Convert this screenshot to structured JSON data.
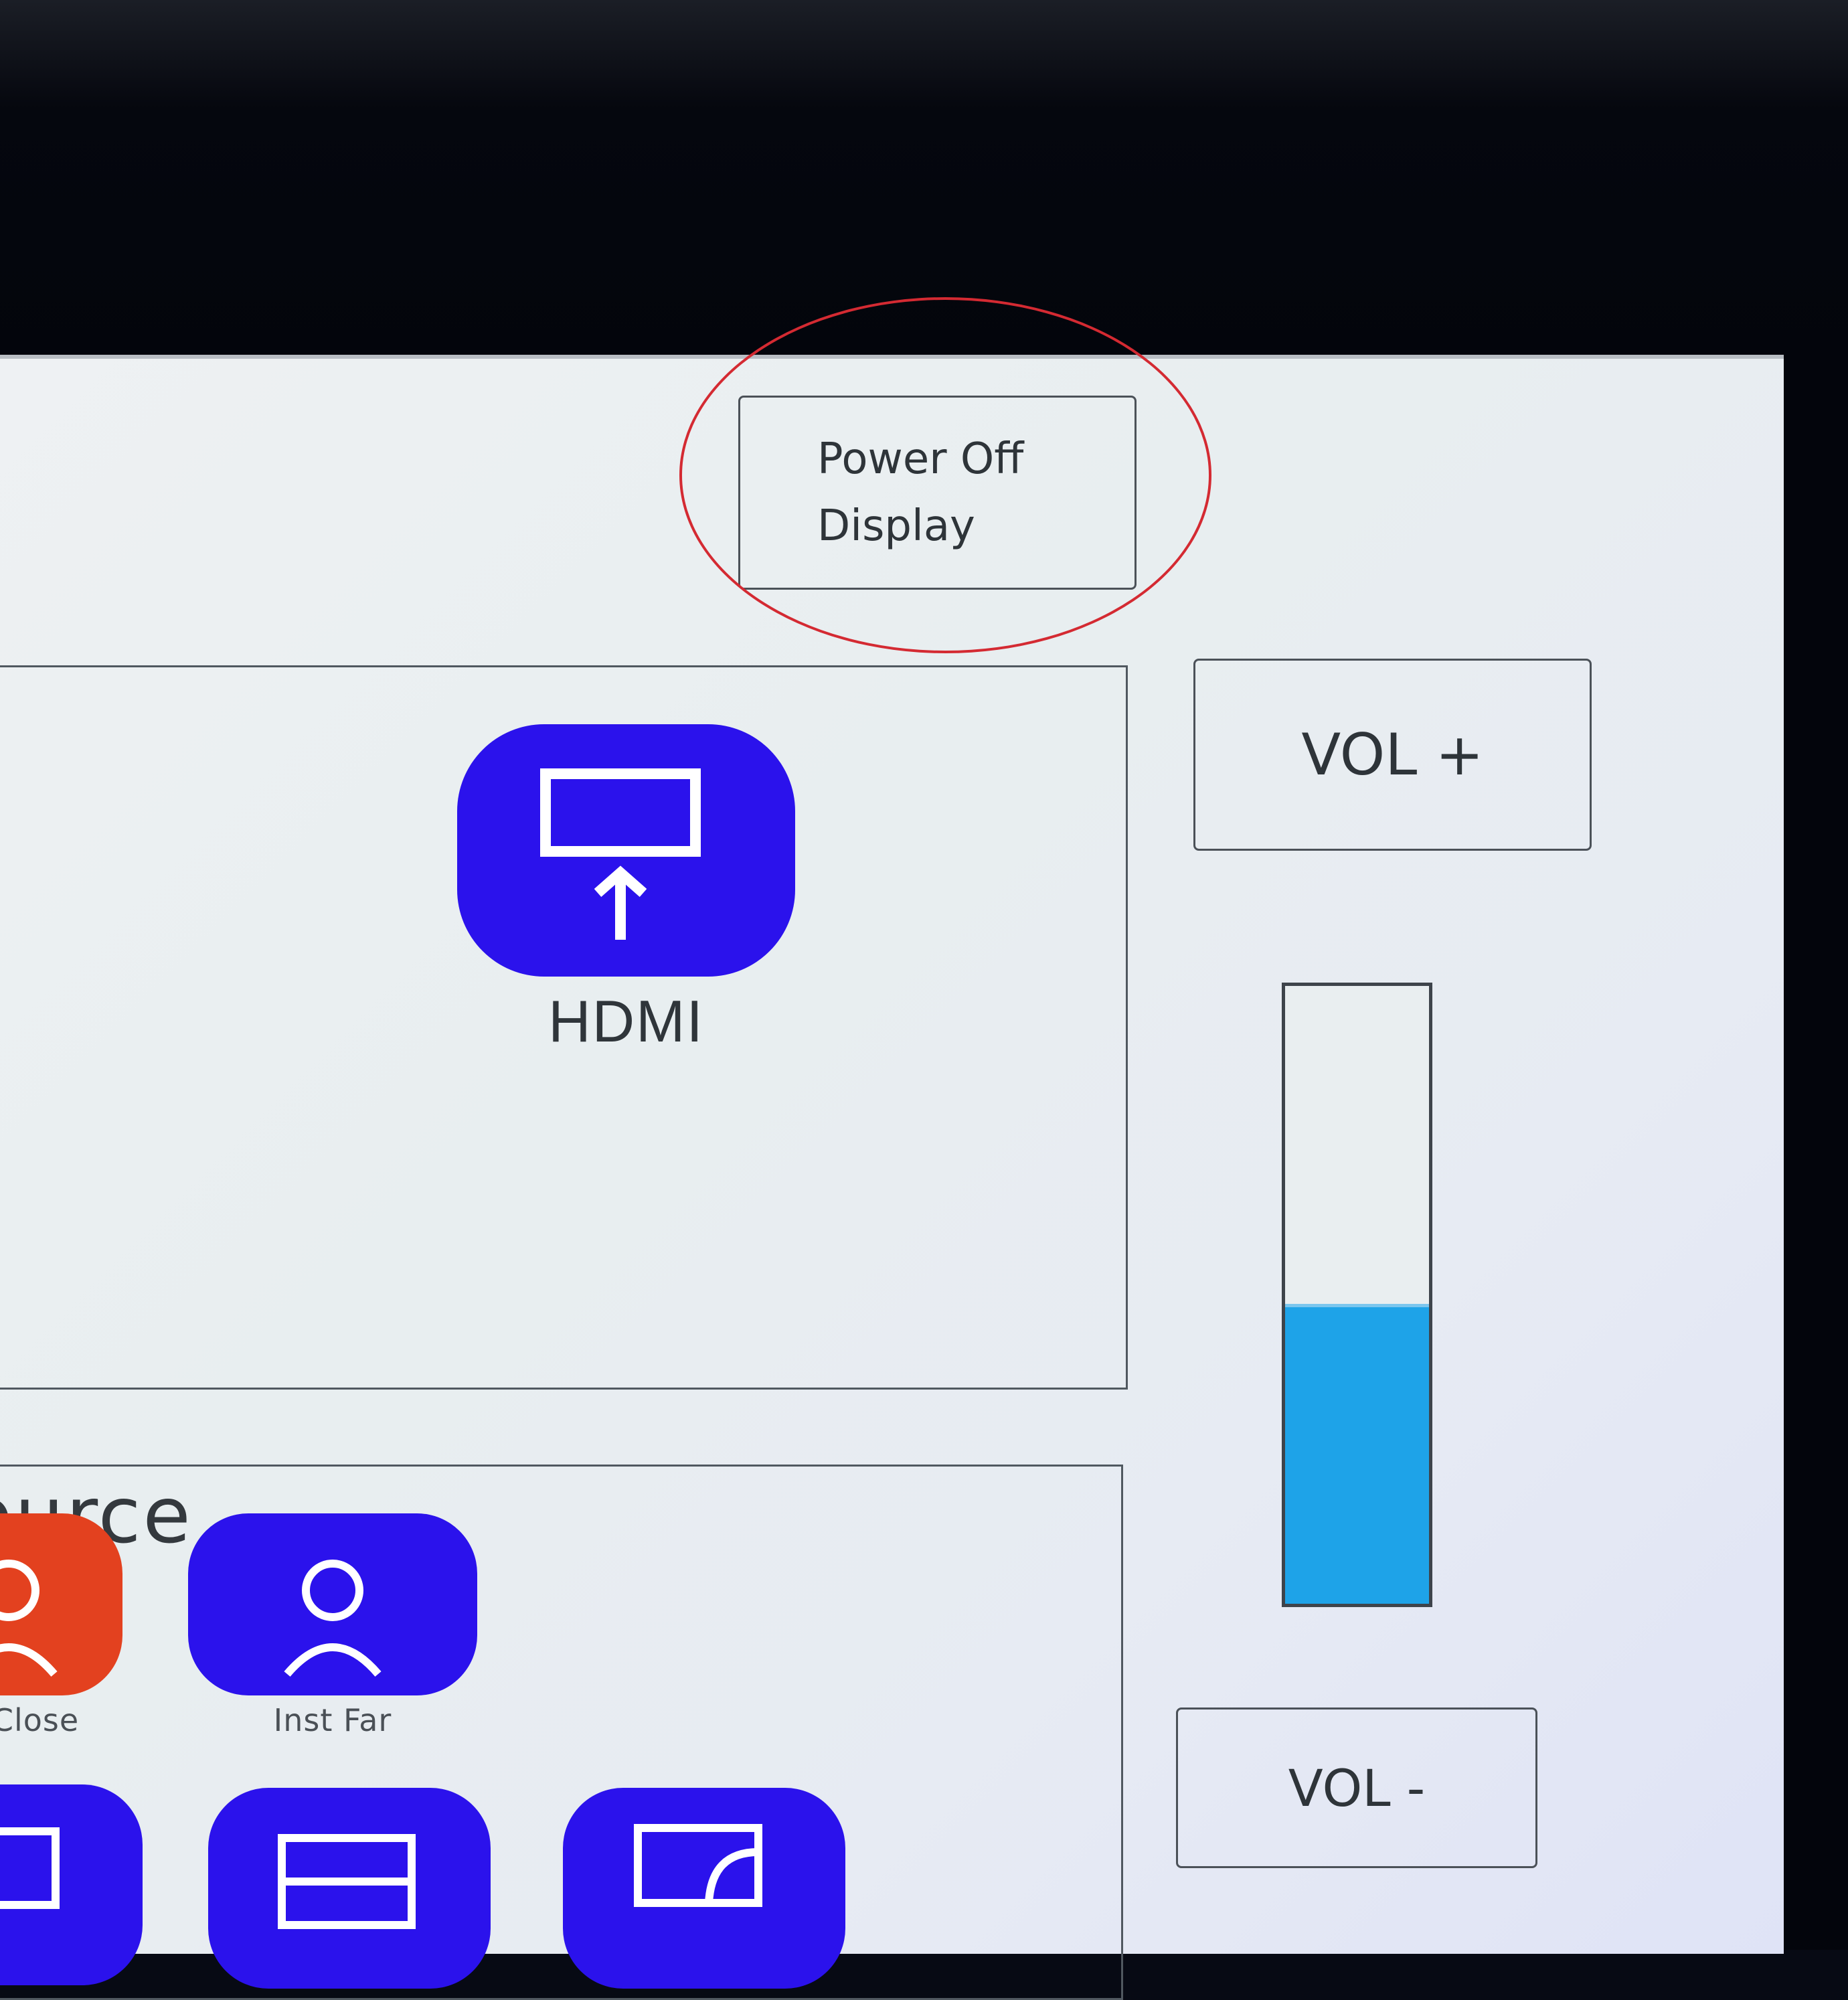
{
  "header": {
    "power_button": {
      "line1": "Power Off",
      "line2": "Display"
    }
  },
  "source_panel": {
    "hdmi": {
      "label": "HDMI",
      "icon": "display-input-icon"
    },
    "title_partial": "ource"
  },
  "volume": {
    "up_label": "VOL +",
    "down_label": "VOL -",
    "level_percent": 48,
    "fill_color": "#1ea3e8"
  },
  "camera_presets": [
    {
      "label": "Close",
      "color": "#e3411f",
      "icon": "person-icon"
    },
    {
      "label": "Inst Far",
      "color": "#2b12ec",
      "icon": "person-icon"
    }
  ],
  "colors": {
    "accent": "#2b12ec",
    "preset_active": "#e3411f",
    "annotation": "#d42a32"
  }
}
